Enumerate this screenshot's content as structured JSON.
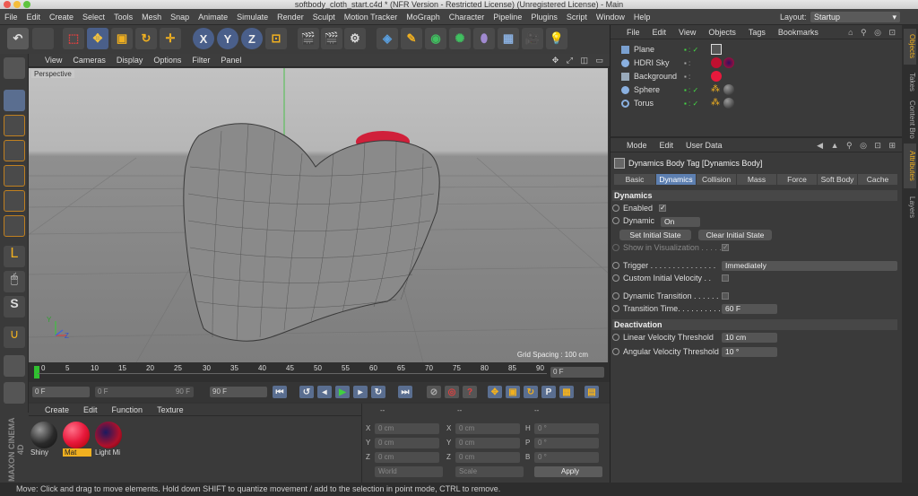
{
  "window_title": "softbody_cloth_start.c4d * (NFR Version - Restricted License) (Unregistered License) - Main",
  "menu": [
    "File",
    "Edit",
    "Create",
    "Select",
    "Tools",
    "Mesh",
    "Snap",
    "Animate",
    "Simulate",
    "Render",
    "Sculpt",
    "Motion Tracker",
    "MoGraph",
    "Character",
    "Pipeline",
    "Plugins",
    "Script",
    "Window",
    "Help"
  ],
  "layout": {
    "label": "Layout:",
    "value": "Startup"
  },
  "viewport_menu": [
    "View",
    "Cameras",
    "Display",
    "Options",
    "Filter",
    "Panel"
  ],
  "viewport": {
    "label": "Perspective",
    "grid_spacing": "Grid Spacing : 100 cm",
    "axis_y": "Y",
    "axis_z": "Z"
  },
  "timeline": {
    "ticks": [
      "0",
      "5",
      "10",
      "15",
      "20",
      "25",
      "30",
      "35",
      "40",
      "45",
      "50",
      "55",
      "60",
      "65",
      "70",
      "75",
      "80",
      "85",
      "90"
    ],
    "end_field": "0 F"
  },
  "playback": {
    "current": "0 F",
    "start": "0 F",
    "range_end": "90 F",
    "max": "90 F"
  },
  "material_menu": [
    "Create",
    "Edit",
    "Function",
    "Texture"
  ],
  "materials": [
    {
      "name": "Shiny",
      "color": "#2a2a2a"
    },
    {
      "name": "Mat",
      "color": "#e8193c"
    },
    {
      "name": "Light Mi",
      "color": "#b0102a"
    }
  ],
  "coords": {
    "headers": [
      "--",
      "--",
      "--"
    ],
    "rows": [
      {
        "a": "X",
        "av": "0 cm",
        "b": "X",
        "bv": "0 cm",
        "c": "H",
        "cv": "0 °"
      },
      {
        "a": "Y",
        "av": "0 cm",
        "b": "Y",
        "bv": "0 cm",
        "c": "P",
        "cv": "0 °"
      },
      {
        "a": "Z",
        "av": "0 cm",
        "b": "Z",
        "bv": "0 cm",
        "c": "B",
        "cv": "0 °"
      }
    ],
    "world": "World",
    "scale": "Scale",
    "apply": "Apply"
  },
  "objects_menu": [
    "File",
    "Edit",
    "View",
    "Objects",
    "Tags",
    "Bookmarks"
  ],
  "objects": [
    {
      "name": "Plane"
    },
    {
      "name": "HDRI Sky"
    },
    {
      "name": "Background"
    },
    {
      "name": "Sphere"
    },
    {
      "name": "Torus"
    }
  ],
  "attr_menu": [
    "Mode",
    "Edit",
    "User Data"
  ],
  "attr_title": "Dynamics Body Tag [Dynamics Body]",
  "attr_tabs": [
    "Basic",
    "Dynamics",
    "Collision",
    "Mass",
    "Force",
    "Soft Body",
    "Cache"
  ],
  "attr_active_tab": "Dynamics",
  "dynamics": {
    "section": "Dynamics",
    "enabled": "Enabled",
    "dynamic": "Dynamic",
    "dynamic_value": "On",
    "set_initial": "Set Initial State",
    "clear_initial": "Clear Initial State",
    "show_in_vis": "Show in Visualization . . . . .",
    "trigger": "Trigger . . . . . . . . . . . . . . .",
    "trigger_value": "Immediately",
    "custom_vel": "Custom Initial Velocity . .",
    "dyn_transition": "Dynamic Transition . . . . . .",
    "transition_time": "Transition Time. . . . . . . . . .",
    "transition_time_value": "60 F"
  },
  "deactivation": {
    "section": "Deactivation",
    "linear": "Linear Velocity Threshold",
    "linear_value": "10 cm",
    "angular": "Angular Velocity Threshold",
    "angular_value": "10 °"
  },
  "side_tabs": [
    "Objects",
    "Takes",
    "Content Bro",
    "Attributes",
    "Layers"
  ],
  "brand": "MAXON CINEMA 4D",
  "status": "Move: Click and drag to move elements. Hold down SHIFT to quantize movement / add to the selection in point mode, CTRL to remove."
}
